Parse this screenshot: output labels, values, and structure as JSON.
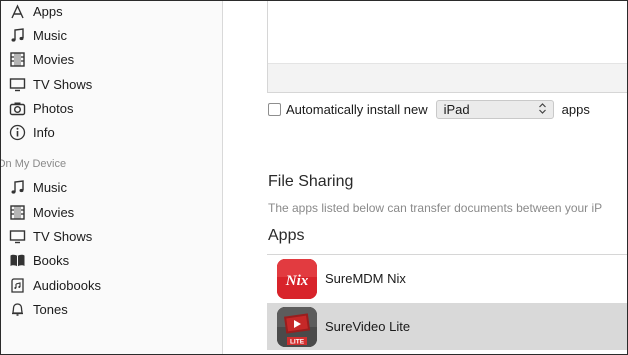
{
  "sidebar": {
    "library_items": [
      {
        "label": "Apps",
        "icon": "apps-icon"
      },
      {
        "label": "Music",
        "icon": "music-note-icon"
      },
      {
        "label": "Movies",
        "icon": "film-icon"
      },
      {
        "label": "TV Shows",
        "icon": "tv-icon"
      },
      {
        "label": "Photos",
        "icon": "camera-icon"
      },
      {
        "label": "Info",
        "icon": "info-icon"
      }
    ],
    "device_header": "On My Device",
    "device_items": [
      {
        "label": "Music",
        "icon": "music-note-icon"
      },
      {
        "label": "Movies",
        "icon": "film-icon"
      },
      {
        "label": "TV Shows",
        "icon": "tv-icon"
      },
      {
        "label": "Books",
        "icon": "book-icon"
      },
      {
        "label": "Audiobooks",
        "icon": "audiobook-icon"
      },
      {
        "label": "Tones",
        "icon": "bell-icon"
      }
    ]
  },
  "main": {
    "auto_install": {
      "label": "Automatically install new",
      "select_value": "iPad",
      "suffix": "apps",
      "checked": false
    },
    "file_sharing": {
      "title": "File Sharing",
      "description": "The apps listed below can transfer documents between your iP"
    },
    "apps": {
      "title": "Apps",
      "items": [
        {
          "name": "SureMDM Nix",
          "icon": "suremdm-nix-app-icon",
          "icon_text": "Nix",
          "selected": false
        },
        {
          "name": "SureVideo Lite",
          "icon": "surevideo-lite-app-icon",
          "icon_text": "LITE",
          "selected": true
        }
      ]
    }
  },
  "colors": {
    "sidebar_bg": "#fafafa",
    "selected_row": "#d9d9d9",
    "nix_red": "#d8232a",
    "muted_text": "#8a8a8a"
  }
}
